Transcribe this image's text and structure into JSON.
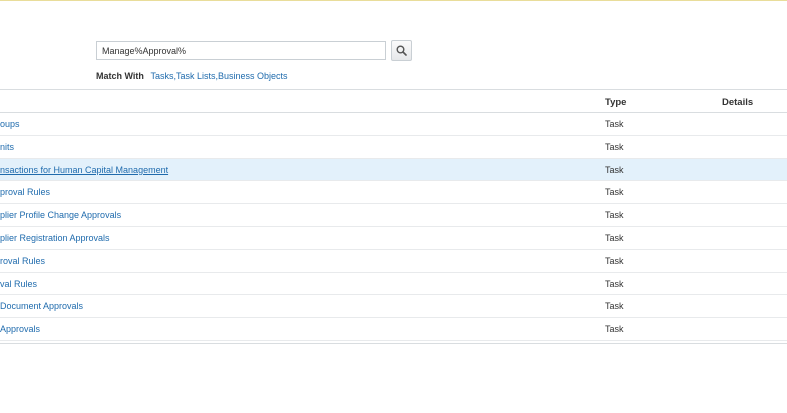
{
  "search": {
    "value": "Manage%Approval%",
    "match_with_label": "Match With",
    "match_with_value": "Tasks,Task Lists,Business Objects"
  },
  "table": {
    "columns": {
      "type": "Type",
      "details": "Details"
    },
    "rows": [
      {
        "name": "oups",
        "type": "Task"
      },
      {
        "name": "nits",
        "type": "Task"
      },
      {
        "name": "nsactions for Human Capital Management",
        "type": "Task",
        "selected": true
      },
      {
        "name": "proval Rules",
        "type": "Task"
      },
      {
        "name": "plier Profile Change Approvals",
        "type": "Task"
      },
      {
        "name": "plier Registration Approvals",
        "type": "Task"
      },
      {
        "name": "roval Rules",
        "type": "Task"
      },
      {
        "name": "val Rules",
        "type": "Task"
      },
      {
        "name": "Document Approvals",
        "type": "Task"
      },
      {
        "name": "Approvals",
        "type": "Task"
      }
    ]
  },
  "colors": {
    "link": "#1f6bad",
    "selected_row": "#e3f1fb"
  },
  "icons": {
    "search_button": "search-icon"
  }
}
